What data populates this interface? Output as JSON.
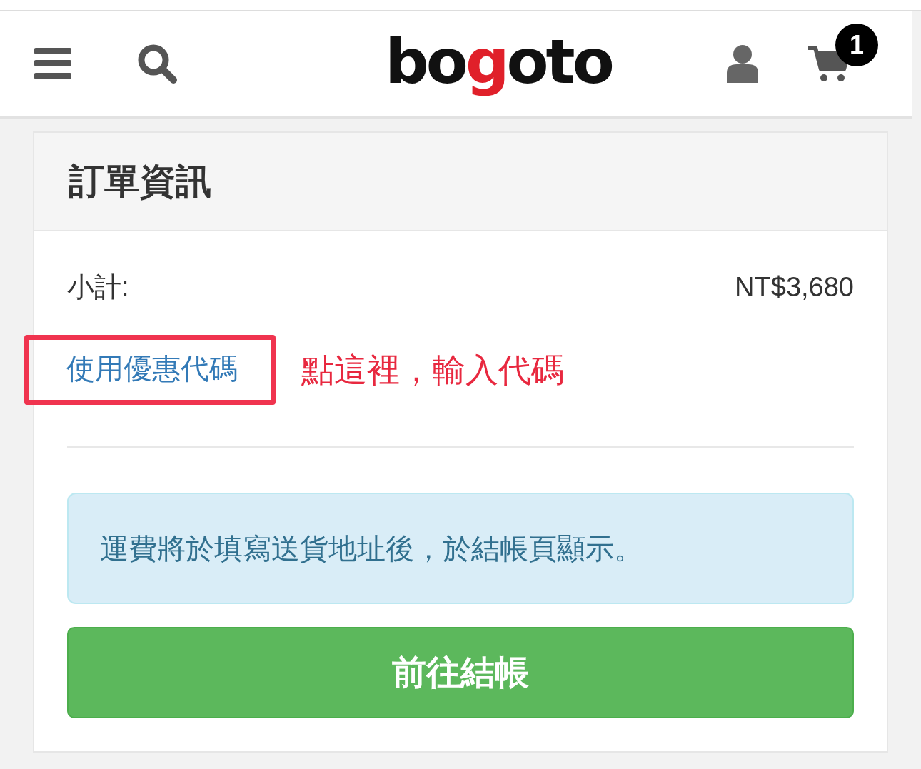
{
  "header": {
    "logo": {
      "parts": [
        {
          "text": "bo"
        },
        {
          "text": "g",
          "color": "#e0202a"
        },
        {
          "text": "oto"
        }
      ]
    },
    "cart_count": "1"
  },
  "order": {
    "title": "訂單資訊",
    "subtotal_label": "小計:",
    "subtotal_value": "NT$3,680",
    "coupon_link": "使用優惠代碼",
    "annotation": "點這裡，輸入代碼",
    "shipping_note": "運費將於填寫送貨地址後，於結帳頁顯示。",
    "checkout_button": "前往結帳"
  }
}
